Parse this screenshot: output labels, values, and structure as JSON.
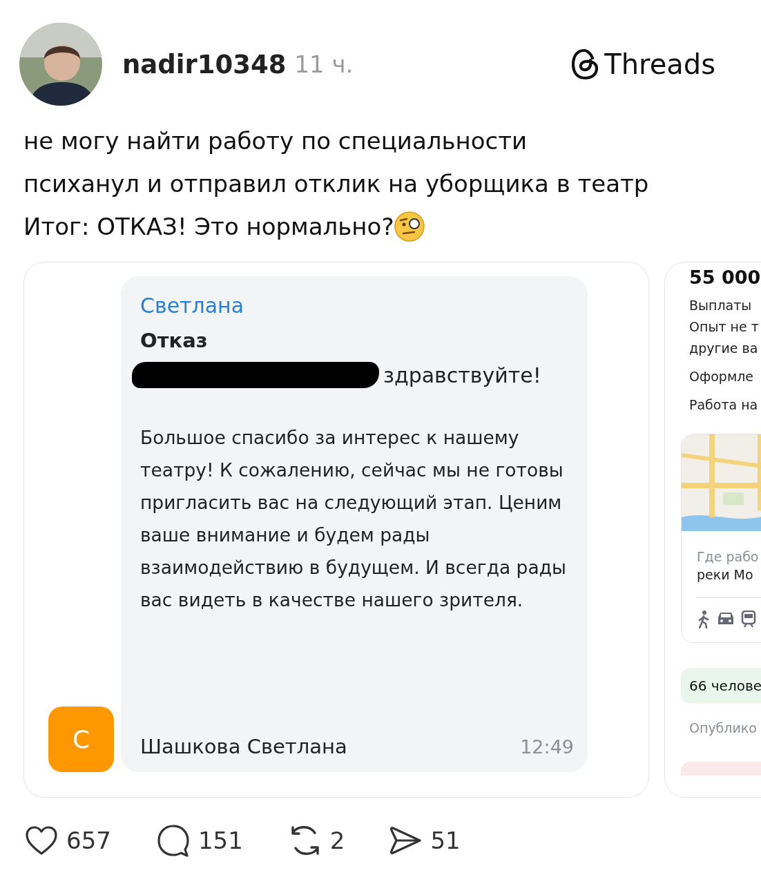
{
  "post": {
    "username": "nadir10348",
    "time": "11 ч.",
    "brand": "Threads",
    "text_lines": [
      "не могу найти работу по специальности",
      "психанул и отправил отклик на уборщика в театр",
      "Итог: ОТКАЗ! Это нормально?"
    ]
  },
  "message": {
    "sender": "Светлана",
    "subject": "Отказ",
    "greeting": "здравствуйте!",
    "avatar": {
      "letter": "С",
      "color": "#ff9800"
    },
    "body": "Большое спасибо за интерес к нашему театру! К сожалению, сейчас мы не готовы пригласить вас на следующий этап. Ценим ваше внимание и будем рады взаимодействию в будущем. И всегда рады вас видеть в качестве нашего зрителя.",
    "signature": "Шашкова Светлана",
    "time": "12:49"
  },
  "vacancy": {
    "salary": "55 000",
    "lines": [
      "Выплаты",
      "Опыт не т",
      "другие ва"
    ],
    "details": [
      "Оформле",
      "Работа на"
    ],
    "map": {
      "kind": "picture"
    },
    "address_hint": "Где рабо",
    "address": "реки Мо",
    "responses": "66 челове",
    "published": "Опублико"
  },
  "actions": [
    {
      "kind": "like",
      "count": "657"
    },
    {
      "kind": "comment",
      "count": "151"
    },
    {
      "kind": "repost",
      "count": "2"
    },
    {
      "kind": "share",
      "count": "51"
    }
  ]
}
